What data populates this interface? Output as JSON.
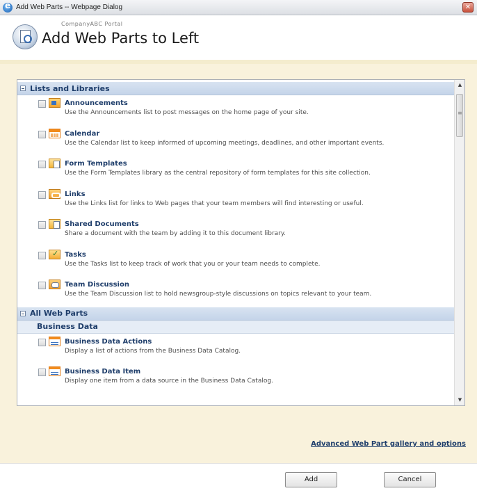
{
  "window": {
    "title": "Add Web Parts -- Webpage Dialog"
  },
  "header": {
    "portal": "CompanyABC Portal",
    "title": "Add Web Parts to Left"
  },
  "lists_section": {
    "label": "Lists and Libraries",
    "items": [
      {
        "name": "Announcements",
        "desc": "Use the Announcements list to post messages on the home page of your site.",
        "icon": "announcements-icon"
      },
      {
        "name": "Calendar",
        "desc": "Use the Calendar list to keep informed of upcoming meetings, deadlines, and other important events.",
        "icon": "calendar-icon"
      },
      {
        "name": "Form Templates",
        "desc": "Use the Form Templates library as the central repository of form templates for this site collection.",
        "icon": "library-icon"
      },
      {
        "name": "Links",
        "desc": "Use the Links list for links to Web pages that your team members will find interesting or useful.",
        "icon": "links-icon"
      },
      {
        "name": "Shared Documents",
        "desc": "Share a document with the team by adding it to this document library.",
        "icon": "library-icon"
      },
      {
        "name": "Tasks",
        "desc": "Use the Tasks list to keep track of work that you or your team needs to complete.",
        "icon": "tasks-icon"
      },
      {
        "name": "Team Discussion",
        "desc": "Use the Team Discussion list to hold newsgroup-style discussions on topics relevant to your team.",
        "icon": "discussion-icon"
      }
    ]
  },
  "all_section": {
    "label": "All Web Parts",
    "category": "Business Data",
    "items": [
      {
        "name": "Business Data Actions",
        "desc": "Display a list of actions from the Business Data Catalog.",
        "icon": "business-data-icon"
      },
      {
        "name": "Business Data Item",
        "desc": "Display one item from a data source in the Business Data Catalog.",
        "icon": "business-data-icon"
      }
    ]
  },
  "advanced_link": "Advanced Web Part gallery and options",
  "buttons": {
    "add": "Add",
    "cancel": "Cancel"
  }
}
